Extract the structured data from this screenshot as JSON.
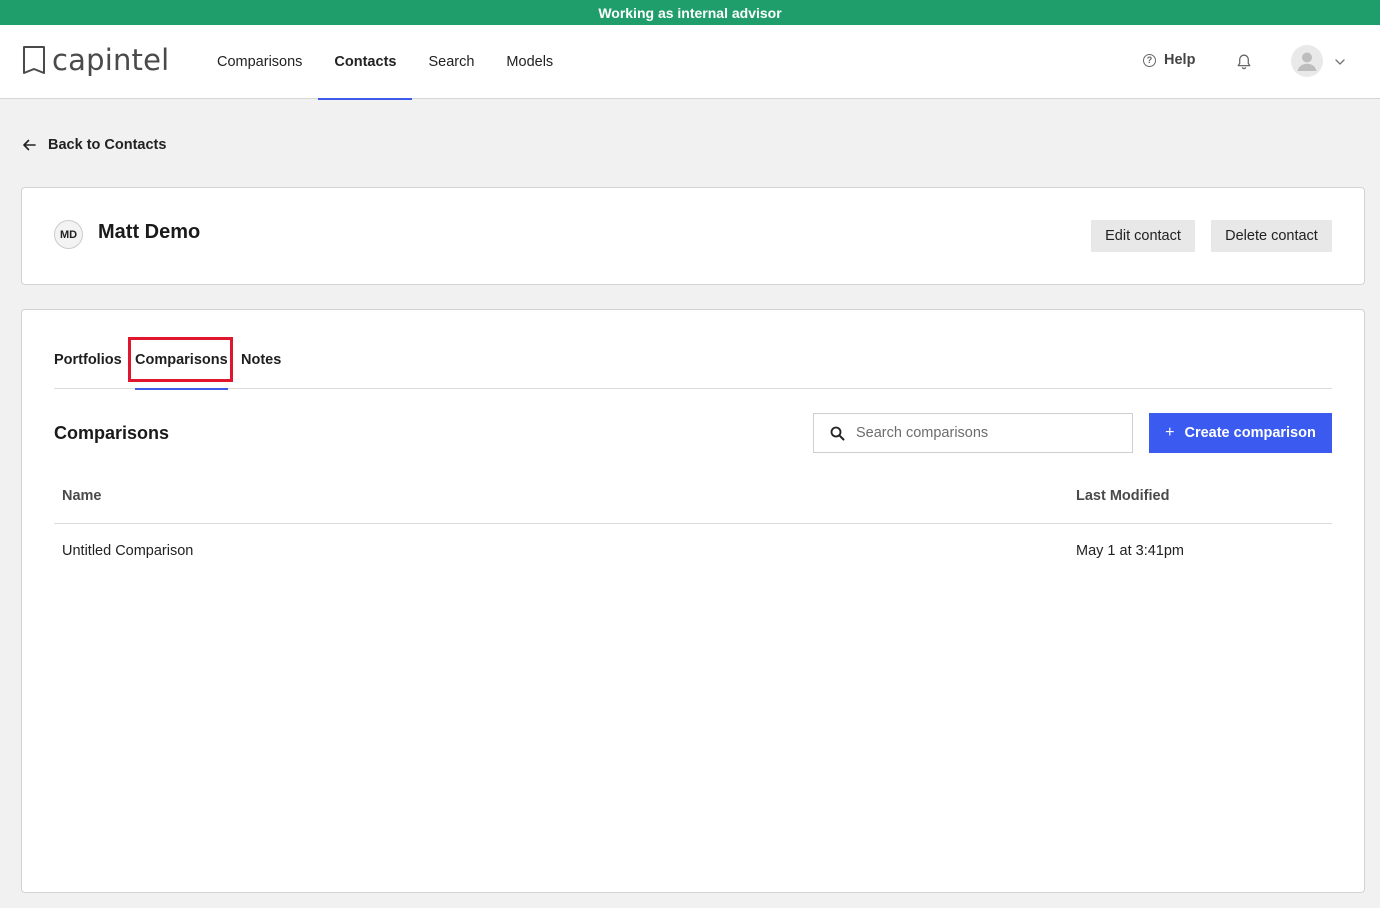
{
  "banner": {
    "text": "Working as internal advisor"
  },
  "brand": {
    "name": "capintel"
  },
  "nav": {
    "items": [
      {
        "label": "Comparisons",
        "active": false
      },
      {
        "label": "Contacts",
        "active": true
      },
      {
        "label": "Search",
        "active": false
      },
      {
        "label": "Models",
        "active": false
      }
    ]
  },
  "header": {
    "help_label": "Help",
    "help_icon": "question-circle-icon",
    "notifications_icon": "bell-icon",
    "avatar_icon": "user-avatar-icon",
    "menu_icon": "chevron-down-icon"
  },
  "back_link": {
    "label": "Back to Contacts",
    "icon": "arrow-left-icon"
  },
  "contact": {
    "initials": "MD",
    "name": "Matt Demo",
    "edit_label": "Edit contact",
    "delete_label": "Delete contact"
  },
  "tabs": [
    {
      "label": "Portfolios",
      "active": false
    },
    {
      "label": "Comparisons",
      "active": true
    },
    {
      "label": "Notes",
      "active": false
    }
  ],
  "comparisons": {
    "title": "Comparisons",
    "search_placeholder": "Search comparisons",
    "search_value": "",
    "create_label": "Create comparison",
    "columns": {
      "name": "Name",
      "last_modified": "Last Modified"
    },
    "rows": [
      {
        "name": "Untitled Comparison",
        "last_modified": "May 1 at 3:41pm"
      }
    ]
  },
  "colors": {
    "banner": "#1f9e6b",
    "accent": "#3b5bf0",
    "highlight": "#e0162f"
  }
}
